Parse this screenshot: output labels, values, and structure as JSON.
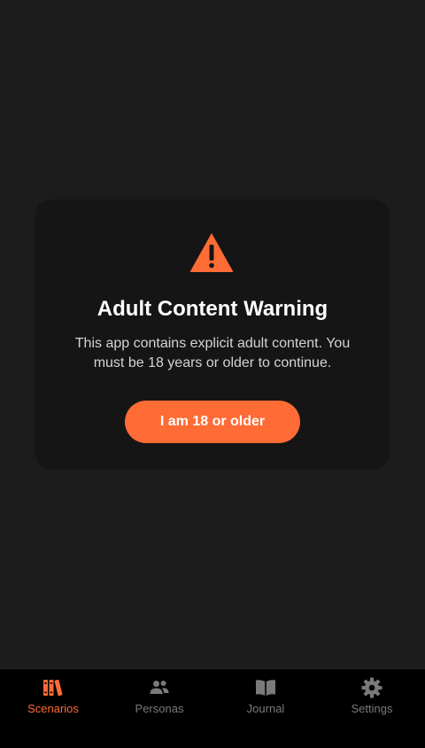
{
  "colors": {
    "accent": "#ff6b35",
    "background": "#1c1c1c",
    "modal_background": "#151515",
    "tab_inactive": "#7a7a7a"
  },
  "modal": {
    "icon": "warning-triangle-icon",
    "title": "Adult Content Warning",
    "message": "This app contains explicit adult content. You must be 18 years or older to continue.",
    "confirm_label": "I am 18 or older"
  },
  "tabbar": {
    "active_tab": "Scenarios",
    "tabs": [
      {
        "label": "Scenarios",
        "icon": "books-icon"
      },
      {
        "label": "Personas",
        "icon": "people-icon"
      },
      {
        "label": "Journal",
        "icon": "open-book-icon"
      },
      {
        "label": "Settings",
        "icon": "gear-icon"
      }
    ]
  }
}
